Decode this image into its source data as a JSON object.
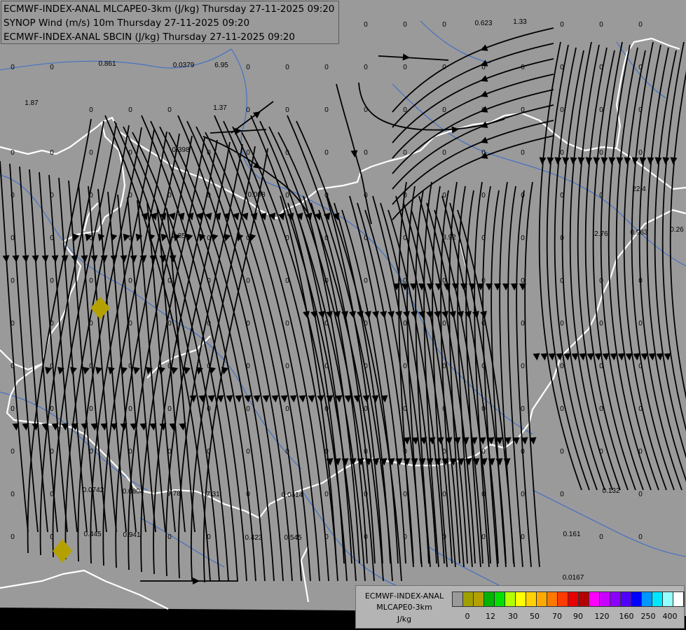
{
  "header": {
    "lines": [
      "ECMWF-INDEX-ANAL MLCAPE0-3km (J/kg) Thursday 27-11-2025 09:20",
      "SYNOP Wind (m/s) 10m Thursday 27-11-2025 09:20",
      "ECMWF-INDEX-ANAL SBCIN (J/kg) Thursday 27-11-2025 09:20"
    ]
  },
  "legend": {
    "title_line1": "ECMWF-INDEX-ANAL",
    "title_line2": "MLCAPE0-3km",
    "unit": "J/kg",
    "colors": [
      "#9a9a9a",
      "#a0a000",
      "#b4a000",
      "#00b400",
      "#00e000",
      "#b4ff00",
      "#ffff00",
      "#ffd200",
      "#ffaa00",
      "#ff7800",
      "#ff3c00",
      "#e60000",
      "#b40000",
      "#ff00ff",
      "#c800ff",
      "#8c00ff",
      "#5000ff",
      "#0000ff",
      "#0096ff",
      "#00e6ff",
      "#96ffff",
      "#ffffff"
    ],
    "ticks": [
      "0",
      "12",
      "30",
      "50",
      "70",
      "90",
      "120",
      "160",
      "250",
      "400"
    ]
  },
  "map": {
    "colors": {
      "background": "#9a9a9a",
      "border": "#ffffff",
      "river": "#3c6ec8",
      "streamline": "#000000",
      "marker": "#b4a000",
      "bottom_band": "#000000"
    },
    "values": [
      "0.623",
      "1.33",
      "0.861",
      "0.0379",
      "6.95",
      "1.87",
      "1.37",
      "0.398",
      "0.008",
      "2.85",
      "3.92",
      "22.4",
      "2.76",
      "0.963",
      "0.26",
      "0.0742",
      "0.0804",
      "9.78",
      "7.31",
      "0.0614",
      "0.445",
      "0.941",
      "0.423",
      "0.545",
      "0.132",
      "0.161",
      "0.0167",
      "0"
    ]
  }
}
